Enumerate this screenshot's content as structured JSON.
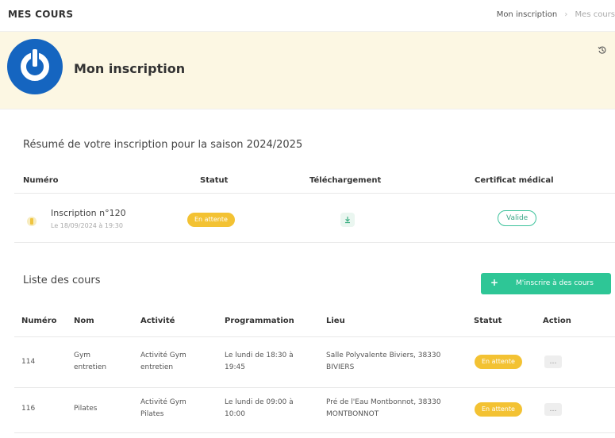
{
  "header": {
    "title": "MES COURS",
    "breadcrumb": {
      "link": "Mon inscription",
      "separator": "›",
      "current": "Mes cours"
    }
  },
  "hero": {
    "title": "Mon inscription",
    "history_icon": "history-icon"
  },
  "summary": {
    "title": "Résumé de votre inscription pour la saison 2024/2025",
    "columns": {
      "numero": "Numéro",
      "statut": "Statut",
      "telechargement": "Téléchargement",
      "certificat": "Certificat médical"
    },
    "row": {
      "name": "Inscription n°120",
      "date": "Le 18/09/2024 à 19:30",
      "status": "En attente",
      "download_icon": "download-icon",
      "certificate": "Valide"
    }
  },
  "courses": {
    "title": "Liste des cours",
    "add_button": {
      "icon": "+",
      "label": "M'inscrire à des cours"
    },
    "columns": {
      "numero": "Numéro",
      "nom": "Nom",
      "activite": "Activité",
      "programmation": "Programmation",
      "lieu": "Lieu",
      "statut": "Statut",
      "action": "Action"
    },
    "rows": [
      {
        "numero": "114",
        "nom": "Gym entretien",
        "activite": "Activité Gym entretien",
        "programmation": "Le lundi de 18:30 à 19:45",
        "lieu": "Salle Polyvalente Biviers, 38330 BIVIERS",
        "statut": "En attente",
        "action": "…"
      },
      {
        "numero": "116",
        "nom": "Pilates",
        "activite": "Activité Gym Pilates",
        "programmation": "Le lundi de 09:00 à 10:00",
        "lieu": "Pré de l'Eau Montbonnot, 38330 MONTBONNOT",
        "statut": "En attente",
        "action": "…"
      }
    ]
  },
  "colors": {
    "hero_bg": "#fcf7e3",
    "logo_blue": "#1565c0",
    "status_yellow": "#f3c233",
    "accent_green": "#2ec696"
  }
}
